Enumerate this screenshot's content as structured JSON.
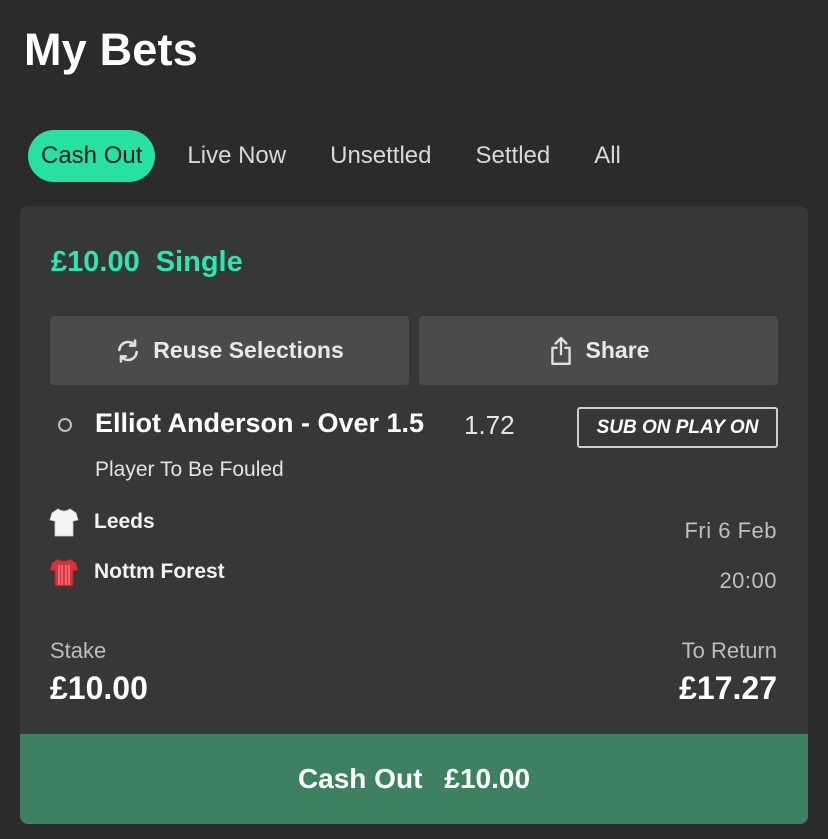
{
  "page": {
    "title": "My Bets"
  },
  "tabs": [
    {
      "label": "Cash Out",
      "active": true
    },
    {
      "label": "Live Now",
      "active": false
    },
    {
      "label": "Unsettled",
      "active": false
    },
    {
      "label": "Settled",
      "active": false
    },
    {
      "label": "All",
      "active": false
    }
  ],
  "bet": {
    "stake_header": "£10.00",
    "type": "Single",
    "actions": {
      "reuse_label": "Reuse Selections",
      "share_label": "Share"
    },
    "selection": {
      "name": "Elliot Anderson - Over 1.5",
      "odds": "1.72",
      "badge": "SUB ON PLAY ON",
      "market": "Player To Be Fouled"
    },
    "event": {
      "home": {
        "name": "Leeds",
        "icon": "white-shirt-icon"
      },
      "away": {
        "name": "Nottm Forest",
        "icon": "red-shirt-icon"
      },
      "date": "Fri 6 Feb",
      "time": "20:00"
    },
    "stake": {
      "label": "Stake",
      "value": "£10.00"
    },
    "to_return": {
      "label": "To Return",
      "value": "£17.27"
    },
    "cashout": {
      "label": "Cash Out",
      "amount": "£10.00"
    }
  },
  "colors": {
    "accent": "#27e0a4",
    "background": "#2b2b2b",
    "card": "#363838",
    "cashout_button": "#3d8162"
  }
}
